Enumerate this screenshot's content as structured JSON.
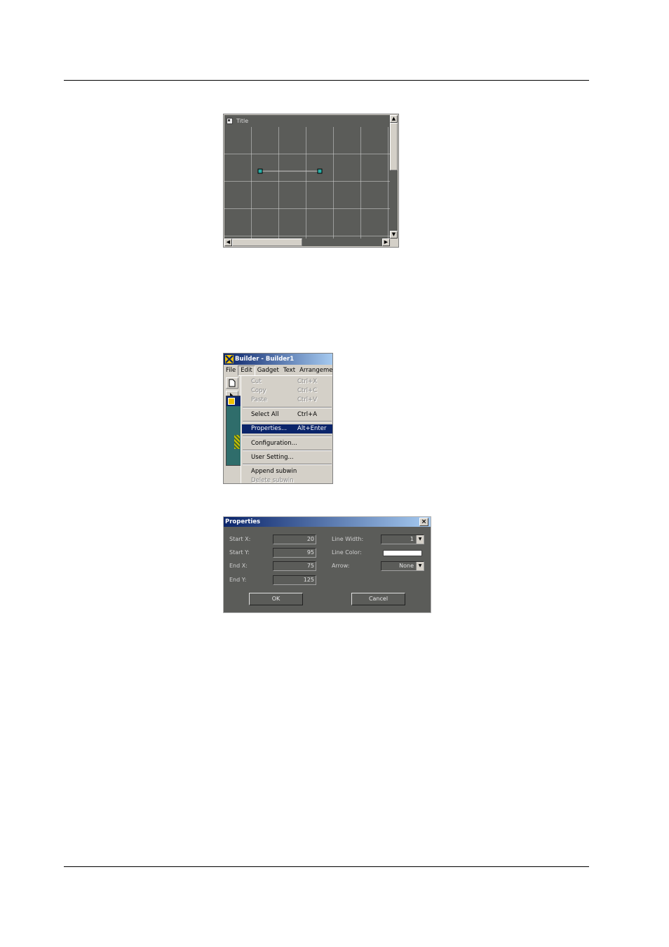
{
  "canvas_window": {
    "title": "Title",
    "scroll_up": "▲",
    "scroll_down": "▼",
    "scroll_left": "◀",
    "scroll_right": "▶"
  },
  "builder_window": {
    "title": "Builder - Builder1",
    "menubar": [
      "File",
      "Edit",
      "Gadget",
      "Text",
      "Arrangemen"
    ],
    "edit_menu": [
      {
        "label": "Cut",
        "shortcut": "Ctrl+X"
      },
      {
        "label": "Copy",
        "shortcut": "Ctrl+C"
      },
      {
        "label": "Paste",
        "shortcut": "Ctrl+V"
      },
      {
        "label": "Select All",
        "shortcut": "Ctrl+A"
      },
      {
        "label": "Properties...",
        "shortcut": "Alt+Enter"
      },
      {
        "label": "Configuration..."
      },
      {
        "label": "User Setting..."
      },
      {
        "label": "Append subwin"
      },
      {
        "label": "Delete subwin"
      }
    ]
  },
  "properties_dialog": {
    "title": "Properties",
    "close": "×",
    "start_x": {
      "label": "Start X:",
      "value": "20"
    },
    "start_y": {
      "label": "Start Y:",
      "value": "95"
    },
    "end_x": {
      "label": "End X:",
      "value": "75"
    },
    "end_y": {
      "label": "End Y:",
      "value": "125"
    },
    "line_width": {
      "label": "Line Width:",
      "value": "1"
    },
    "line_color": {
      "label": "Line Color:",
      "value": "#ffffff"
    },
    "arrow": {
      "label": "Arrow:",
      "value": "None"
    },
    "ok": "OK",
    "cancel": "Cancel",
    "dropdown_arrow": "▼"
  },
  "colors": {
    "canvas_gray": "#5b5c59",
    "dialog_face": "#d4d0c8",
    "title_active": "#0a246a",
    "selected_line": "#c8c8c8",
    "handle": "#2ab0a8"
  }
}
